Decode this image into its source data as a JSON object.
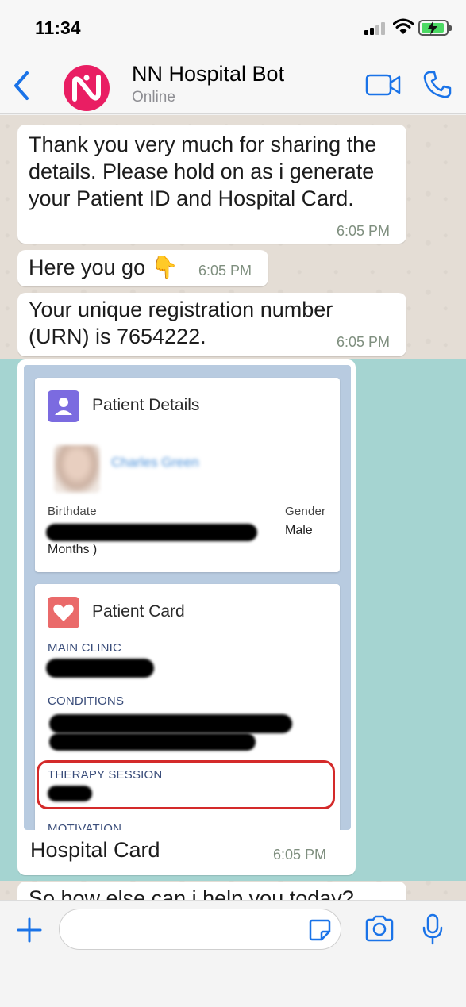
{
  "status_bar": {
    "time": "11:34"
  },
  "header": {
    "contact_name": "NN Hospital Bot",
    "contact_status": "Online",
    "icons": {
      "back": "chevron-left-icon",
      "video": "video-camera-icon",
      "call": "phone-icon"
    }
  },
  "messages": [
    {
      "text": "Thank you very much for sharing the details. Please hold on as i generate your Patient ID and Hospital Card.",
      "time": "6:05 PM"
    },
    {
      "text": "Here you go 👇",
      "time": "6:05 PM"
    },
    {
      "text": "Your unique registration number (URN) is 7654222.",
      "time": "6:05 PM"
    },
    {
      "caption": "Hospital Card",
      "time": "6:05 PM"
    },
    {
      "text": "So how else can i help you today?"
    }
  ],
  "card": {
    "patient_details": {
      "title": "Patient Details",
      "name": "Charles Green",
      "birthdate_label": "Birthdate",
      "birthdate_tail": "Months )",
      "gender_label": "Gender",
      "gender_value": "Male"
    },
    "patient_card": {
      "title": "Patient Card",
      "main_clinic_label": "MAIN CLINIC",
      "conditions_label": "CONDITIONS",
      "therapy_label": "THERAPY SESSION",
      "motivation_label": "MOTIVATION"
    }
  },
  "input": {
    "placeholder": ""
  },
  "colors": {
    "accent": "#1a73e8",
    "bot_avatar": "#e91e63",
    "selection": "#a5d4d1",
    "highlight": "#d42a2a"
  }
}
